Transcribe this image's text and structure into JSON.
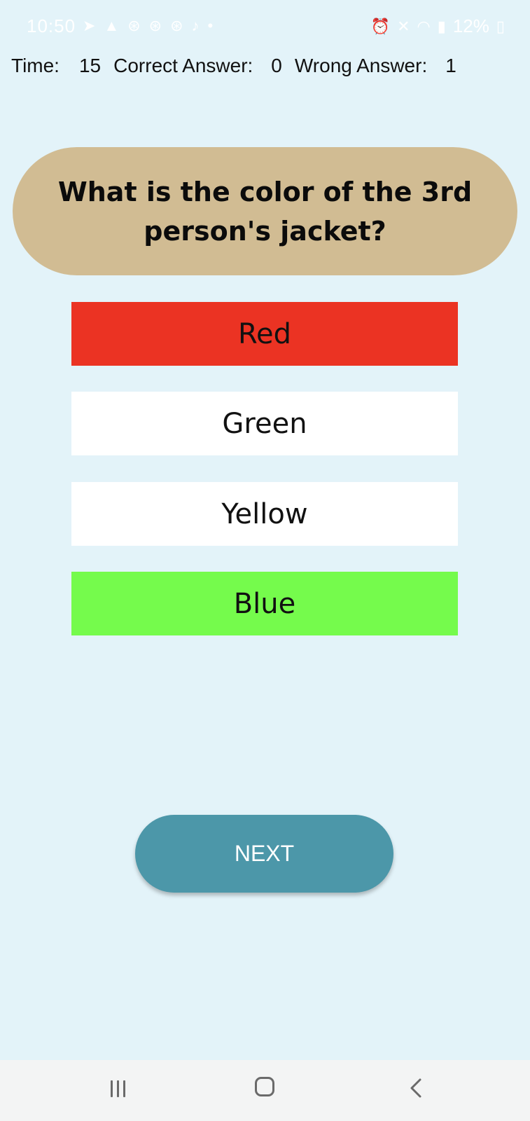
{
  "status_bar": {
    "time": "10:50",
    "battery": "12%",
    "left_icons": [
      "telegram-icon",
      "warning-icon",
      "notification-icon",
      "notification-icon",
      "notification-icon",
      "bell-icon",
      "dot-icon"
    ],
    "right_icons": [
      "alarm-icon",
      "mute-icon",
      "wifi-icon",
      "signal-icon",
      "battery-icon"
    ]
  },
  "score": {
    "time_label": "Time:",
    "time_value": "15",
    "correct_label": "Correct Answer:",
    "correct_value": "0",
    "wrong_label": "Wrong Answer:",
    "wrong_value": "1"
  },
  "question": {
    "text": "What is the color of the 3rd person's jacket?"
  },
  "options": [
    {
      "label": "Red",
      "state": "wrong-selected",
      "color": "#eb3323"
    },
    {
      "label": "Green",
      "state": "neutral",
      "color": "#ffffff"
    },
    {
      "label": "Yellow",
      "state": "neutral",
      "color": "#ffffff"
    },
    {
      "label": "Blue",
      "state": "correct",
      "color": "#75fb4c"
    }
  ],
  "next_button": {
    "label": "NEXT"
  },
  "colors": {
    "background": "#e3f3f9",
    "question_card": "#d1bc93",
    "wrong": "#eb3323",
    "correct": "#75fb4c",
    "next_button": "#4c97a9"
  }
}
